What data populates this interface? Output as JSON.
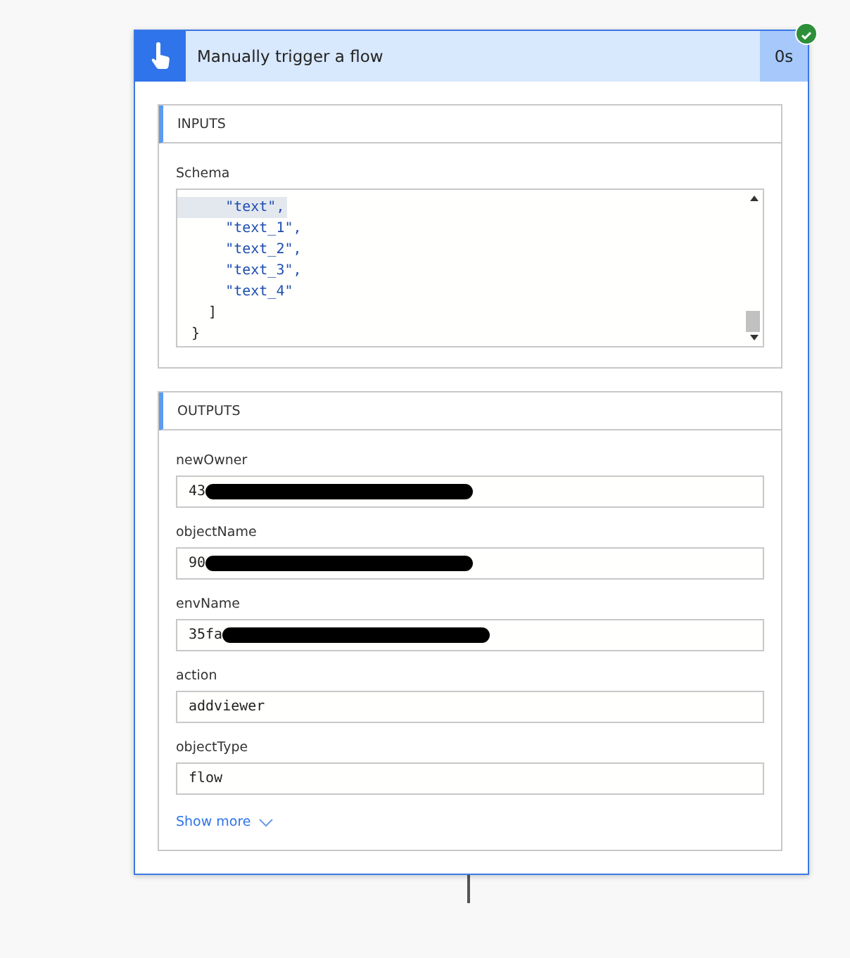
{
  "trigger": {
    "title": "Manually trigger a flow",
    "duration": "0s",
    "succeeded": true
  },
  "inputs": {
    "heading": "INPUTS",
    "fields": [
      {
        "label": "Schema",
        "kind": "code",
        "lines": [
          {
            "text": "    \"text\",",
            "kind": "string",
            "highlighted": true
          },
          {
            "text": "    \"text_1\",",
            "kind": "string",
            "highlighted": false
          },
          {
            "text": "    \"text_2\",",
            "kind": "string",
            "highlighted": false
          },
          {
            "text": "    \"text_3\",",
            "kind": "string",
            "highlighted": false
          },
          {
            "text": "    \"text_4\"",
            "kind": "string",
            "highlighted": false
          },
          {
            "text": "  ]",
            "kind": "punct",
            "highlighted": false
          },
          {
            "text": "}",
            "kind": "punct",
            "highlighted": false
          }
        ]
      }
    ]
  },
  "outputs": {
    "heading": "OUTPUTS",
    "fields": [
      {
        "label": "newOwner",
        "kind": "text",
        "value": "43",
        "redacted": true
      },
      {
        "label": "objectName",
        "kind": "text",
        "value": "90",
        "redacted": true
      },
      {
        "label": "envName",
        "kind": "text",
        "value": "35fa",
        "redacted": true
      },
      {
        "label": "action",
        "kind": "text",
        "value": "addviewer",
        "redacted": false
      },
      {
        "label": "objectType",
        "kind": "text",
        "value": "flow",
        "redacted": false
      }
    ],
    "show_more": "Show more"
  }
}
